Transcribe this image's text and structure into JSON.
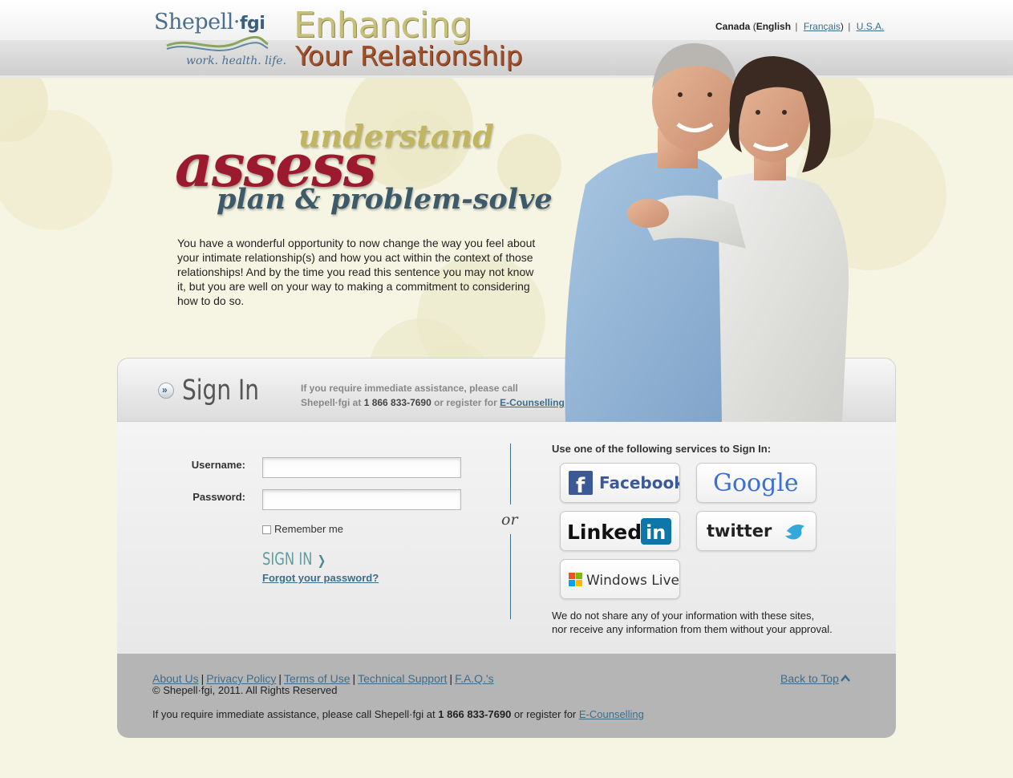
{
  "header": {
    "logo_name": "Shepell·",
    "logo_name_bold": "fgi",
    "logo_tagline": "work. health. life.",
    "title_line1": "Enhancing",
    "title_line2": "Your Relationship"
  },
  "language": {
    "country": "Canada",
    "open_paren": "(",
    "english": "English",
    "francais": "Français",
    "close_paren": ")",
    "separator": "|",
    "usa": "U.S.A."
  },
  "hero": {
    "word_understand": "understand",
    "word_assess": "assess",
    "word_plan": "plan & problem-solve",
    "intro": "You have a wonderful opportunity to now change the way you feel about your intimate relationship(s) and how you act within the context of those relationships! And by the time you read this sentence you may not know it, but you are well on your way to making a commitment to considering how to do so."
  },
  "signin": {
    "title": "Sign In",
    "assist_line1": "If you require immediate assistance, please call",
    "assist_pre": "Shepell·fgi at ",
    "assist_phone": "1 866 833-7690",
    "assist_mid": " or register for ",
    "assist_link": "E-Counselling",
    "username_label": "Username:",
    "password_label": "Password:",
    "remember_label": "Remember me",
    "button_label": "SIGN IN",
    "forgot_label": "Forgot your password?",
    "or_label": "or"
  },
  "services": {
    "label": "Use one of the following services to Sign In:",
    "facebook": "Facebook",
    "google": "Google",
    "linkedin_pre": "Linked",
    "linkedin_in": "in",
    "twitter": "twitter",
    "windows_live": "Windows Live",
    "disclaimer_line1": "We do not share any of your information with these sites,",
    "disclaimer_line2": "nor receive any information from them without your approval."
  },
  "footer": {
    "links": [
      "About Us",
      "Privacy Policy",
      "Terms of Use",
      "Technical Support",
      "F.A.Q.'s"
    ],
    "separator": "|",
    "copyright": "© Shepell·fgi, 2011. All Rights Reserved",
    "assist_pre": "If you require immediate assistance, please call Shepell·fgi at ",
    "assist_phone": "1 866 833-7690",
    "assist_mid": " or register for ",
    "assist_link": "E-Counselling",
    "back_to_top": "Back to Top"
  },
  "colors": {
    "background": "#f6f4e2",
    "assess_red": "#9b1a2e",
    "link_blue": "#3d6d8a",
    "sign_in_teal": "#5f9ea0",
    "footer_gray": "#b5b5b5"
  }
}
